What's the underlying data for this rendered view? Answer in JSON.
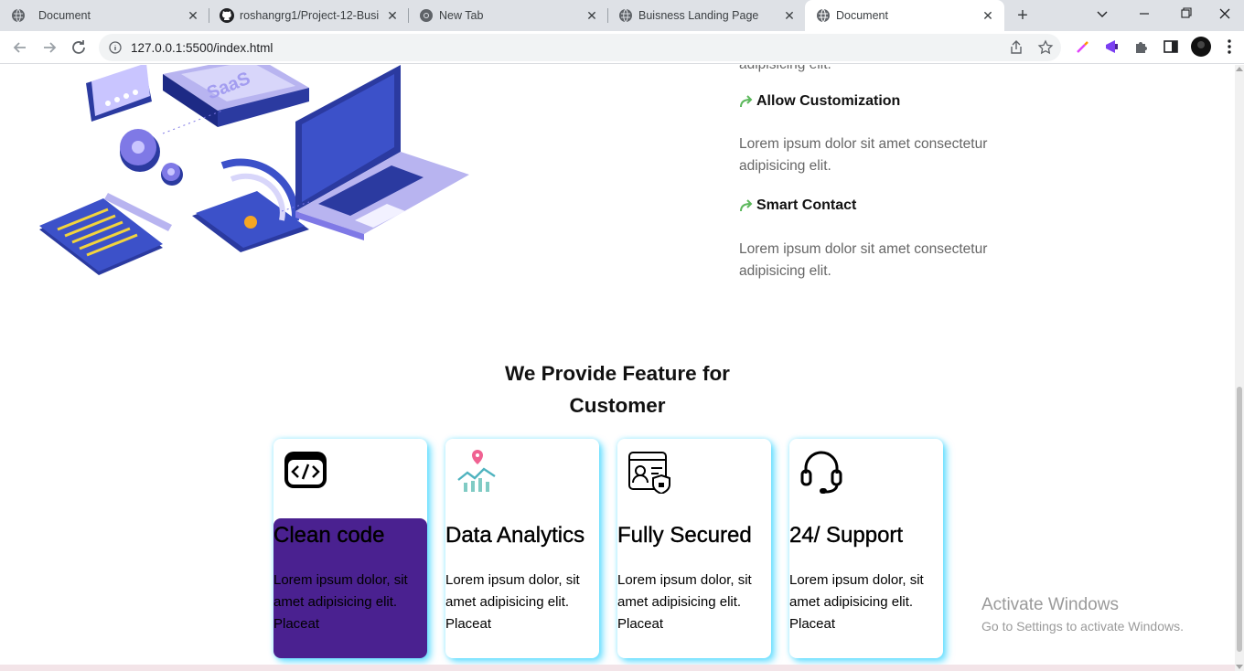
{
  "browser": {
    "tabs": [
      {
        "title": "Document",
        "icon": "globe-icon"
      },
      {
        "title": "roshangrg1/Project-12-Busin",
        "icon": "github-icon"
      },
      {
        "title": "New Tab",
        "icon": "chrome-icon"
      },
      {
        "title": "Buisness Landing Page",
        "icon": "globe-icon"
      },
      {
        "title": "Document",
        "icon": "globe-icon"
      }
    ],
    "url": "127.0.0.1:5500/index.html"
  },
  "page": {
    "cut_text": "adipisicing elit.",
    "features": [
      {
        "title": "Allow Customization",
        "desc": "Lorem ipsum dolor sit amet consectetur adipisicing elit."
      },
      {
        "title": "Smart Contact",
        "desc": "Lorem ipsum dolor sit amet consectetur adipisicing elit."
      }
    ],
    "section_title": "We Provide Feature for Customer",
    "cards": [
      {
        "title": "Clean code",
        "desc": "Lorem ipsum dolor, sit amet adipisicing elit. Placeat",
        "icon": "code-window-icon"
      },
      {
        "title": "Data Analytics",
        "desc": "Lorem ipsum dolor, sit amet adipisicing elit. Placeat",
        "icon": "analytics-chart-icon"
      },
      {
        "title": "Fully Secured",
        "desc": "Lorem ipsum dolor, sit amet adipisicing elit. Placeat",
        "icon": "secure-profile-icon"
      },
      {
        "title": "24/ Support",
        "desc": "Lorem ipsum dolor, sit amet adipisicing elit. Placeat",
        "icon": "headset-icon"
      }
    ],
    "hero_art_label": "SaaS"
  },
  "watermark": {
    "line1": "Activate Windows",
    "line2": "Go to Settings to activate Windows."
  },
  "colors": {
    "card_highlight": "#4a2190",
    "card_glow": "#00c8ff",
    "arrow_green": "#5cb85c"
  }
}
